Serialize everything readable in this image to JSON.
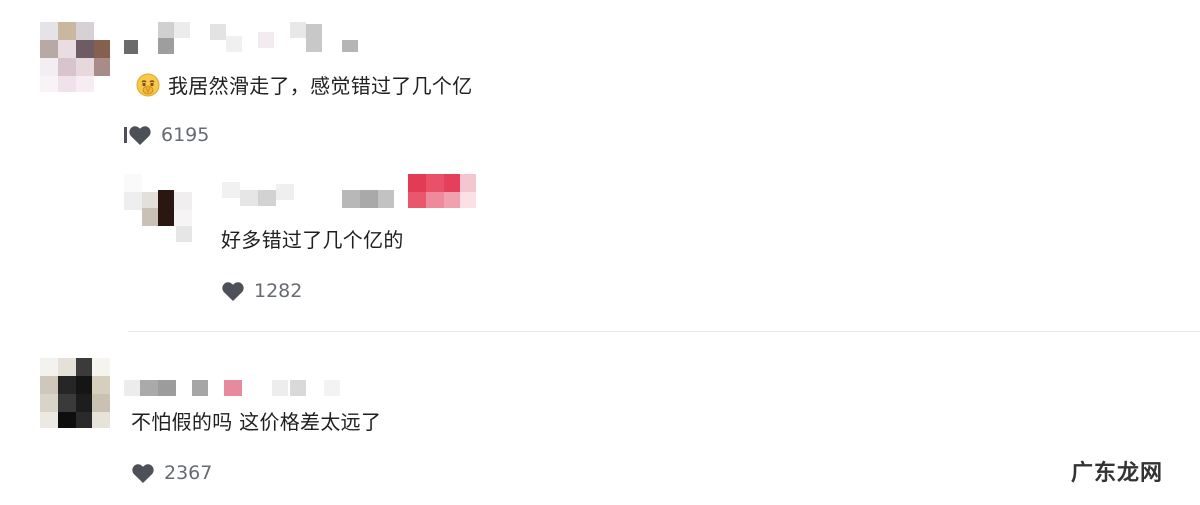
{
  "comments": [
    {
      "text": "我居然滑走了，感觉错过了几个亿",
      "likes": "6195",
      "emoji": "praying-face-emoji"
    },
    {
      "text": "好多错过了几个亿的",
      "likes": "1282"
    },
    {
      "text": "不怕假的吗 这价格差太远了",
      "likes": "2367"
    }
  ],
  "watermark": "广东龙网",
  "colors": {
    "text": "#1f1f1f",
    "like_icon": "#4d5058",
    "like_count": "#666a73",
    "divider": "#e8e8ea"
  }
}
